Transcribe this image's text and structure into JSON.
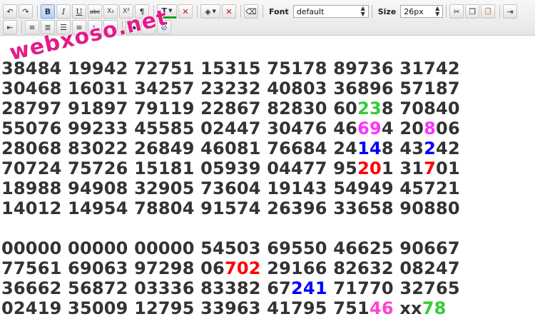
{
  "toolbar": {
    "font_label": "Font",
    "font_value": "default",
    "size_label": "Size",
    "size_value": "26px",
    "row1_icons": [
      "undo-icon",
      "redo-icon",
      "bold-icon",
      "italic-icon",
      "underline-icon",
      "strikethrough-icon",
      "subscript-icon",
      "superscript-icon",
      "paragraph-icon",
      "text-color-icon",
      "clear-color-icon",
      "fill-color-icon",
      "no-fill-icon",
      "eraser-icon"
    ],
    "row1_glyphs": [
      "↶",
      "↷",
      "B",
      "I",
      "U",
      "abc",
      "X₂",
      "X²",
      "¶",
      "T",
      "✕",
      "◈",
      "✕",
      "⌫"
    ],
    "row1_right_icons": [
      "cut-icon",
      "copy-icon",
      "paste-icon",
      "indent-icon"
    ],
    "row1_right_glyphs": [
      "✂",
      "❐",
      "📋",
      "⇥"
    ],
    "row2_icons": [
      "outdent-icon",
      "align-left-icon",
      "align-justify-icon",
      "align-center-icon",
      "align-right-icon",
      "ordered-list-icon",
      "unordered-list-icon",
      "horizontal-rule-icon",
      "link-icon",
      "unlink-icon"
    ],
    "row2_glyphs": [
      "⇤",
      "≡",
      "≣",
      "☰",
      "≡",
      "⒈",
      "•",
      "▬",
      "∞",
      "⊘"
    ]
  },
  "watermark": "webxoso.net",
  "block1": [
    "38484 19942 72751 15315 75178 89736 31742",
    "30468 16031 34257 23232 40803 36896 57187",
    "28797 91897 79119 22867 82830 60238 70840",
    "55076 99233 45585 02447 30476 46694 20806",
    "28068 83022 26849 46081 76684 24148 43242",
    "70724 75726 15181 05939 04477 95201 31701",
    "18988 94908 32905 73604 19143 54949 45721",
    "14012 14954 78804 91574 26396 33658 90880"
  ],
  "block2": [
    "00000 00000 00000 54503 69550 46625 90667",
    "77561 69063 97298 06702 29166 82632 08247",
    "36662 56872 03336 83382 67241 71770 32765",
    "02419 35009 12795 33963 41795 75146 xx78"
  ],
  "highlights": [
    {
      "text": "23",
      "color": "#33cc33"
    },
    {
      "text": "69",
      "color": "#ff33ff"
    },
    {
      "text": "8",
      "color": "#ff33ff"
    },
    {
      "text": "14",
      "color": "#0000ff"
    },
    {
      "text": "2",
      "color": "#0000ff"
    },
    {
      "text": "20",
      "color": "#ff0000"
    },
    {
      "text": "7",
      "color": "#ff0000"
    },
    {
      "text": "702",
      "color": "#ff0000"
    },
    {
      "text": "241",
      "color": "#0000ff"
    },
    {
      "text": "46",
      "color": "#ff44cc"
    },
    {
      "text": "78",
      "color": "#33cc33"
    }
  ]
}
